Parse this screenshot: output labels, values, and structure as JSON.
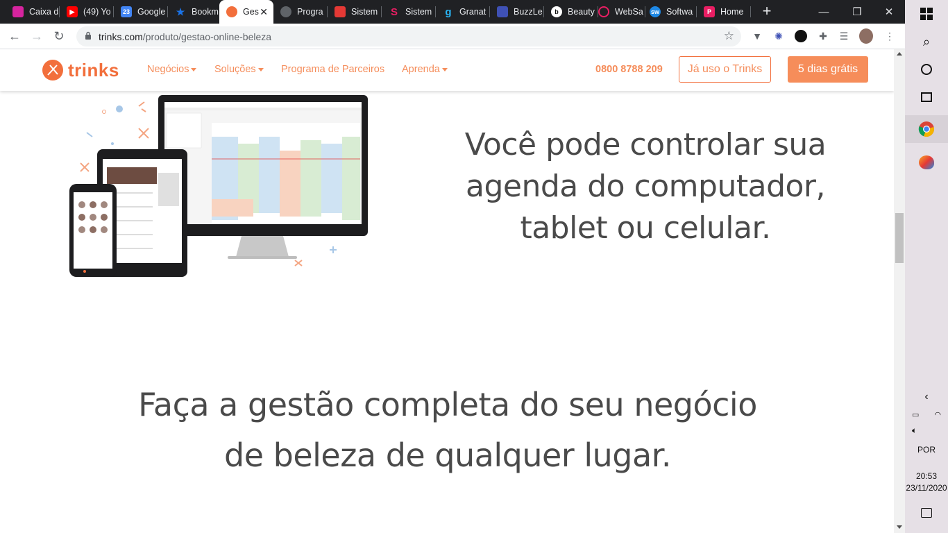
{
  "browser": {
    "tabs": [
      {
        "title": "Caixa d",
        "icon": "instagram-icon",
        "color": "#d6249f"
      },
      {
        "title": "(49) Yo",
        "icon": "youtube-icon",
        "color": "#ff0000"
      },
      {
        "title": "Google",
        "icon": "google-calendar-icon",
        "color": "#4285f4"
      },
      {
        "title": "Bookm",
        "icon": "star-icon",
        "color": "#1a73e8"
      },
      {
        "title": "Ges",
        "icon": "trinks-icon",
        "color": "#f26f3c",
        "active": true
      },
      {
        "title": "Progra",
        "icon": "globe-icon",
        "color": "#9aa0a6"
      },
      {
        "title": "Sistem",
        "icon": "flag-icon",
        "color": "#e53935"
      },
      {
        "title": "Sistem",
        "icon": "s-logo-icon",
        "color": "#e91e63"
      },
      {
        "title": "Granat",
        "icon": "g-logo-icon",
        "color": "#29b6f6"
      },
      {
        "title": "BuzzLe",
        "icon": "buzz-icon",
        "color": "#3f51b5"
      },
      {
        "title": "Beauty",
        "icon": "b-logo-icon",
        "color": "#111111"
      },
      {
        "title": "WebSa",
        "icon": "target-icon",
        "color": "#e91e63"
      },
      {
        "title": "Softwa",
        "icon": "sw-logo-icon",
        "color": "#1e88e5"
      },
      {
        "title": "Home",
        "icon": "p-logo-icon",
        "color": "#e91e63"
      }
    ],
    "new_tab": "+",
    "window_controls": {
      "minimize": "—",
      "restore": "❐",
      "close": "✕"
    },
    "url_host": "trinks.com",
    "url_path": "/produto/gestao-online-beleza"
  },
  "site": {
    "logo_text": "trinks",
    "nav": [
      {
        "label": "Negócios",
        "dropdown": true
      },
      {
        "label": "Soluções",
        "dropdown": true
      },
      {
        "label": "Programa de Parceiros",
        "dropdown": false
      },
      {
        "label": "Aprenda",
        "dropdown": true
      }
    ],
    "phone": "0800 8788 209",
    "login_button": "Já uso o Trinks",
    "trial_button": "5 dias grátis",
    "accent": "#f26f3c"
  },
  "content": {
    "headline1_line1": "Você pode controlar sua",
    "headline1_line2": "agenda do computador,",
    "headline1_line3": "tablet ou celular.",
    "headline2_line1": "Faça a gestão completa do seu negócio",
    "headline2_line2": "de beleza de qualquer lugar."
  },
  "taskbar": {
    "language": "POR",
    "time": "20:53",
    "date": "23/11/2020"
  }
}
